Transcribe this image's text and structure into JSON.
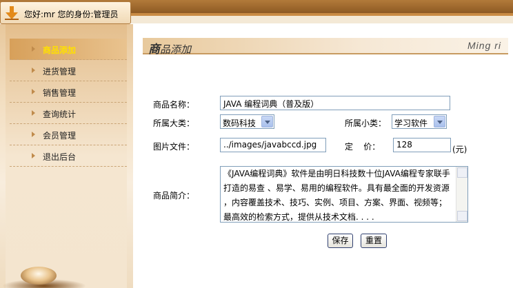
{
  "header": {
    "greeting": "您好:mr 您的身份:管理员"
  },
  "sidebar": {
    "items": [
      {
        "label": "商品添加",
        "active": true
      },
      {
        "label": "进货管理",
        "active": false
      },
      {
        "label": "销售管理",
        "active": false
      },
      {
        "label": "查询统计",
        "active": false
      },
      {
        "label": "会员管理",
        "active": false
      },
      {
        "label": "退出后台",
        "active": false
      }
    ]
  },
  "page": {
    "title_bold": "商",
    "title_rest": "品添加",
    "brand": "Ming ri"
  },
  "form": {
    "name_label": "商品名称：",
    "name_value": "JAVA 编程词典（普及版）",
    "category_label": "所属大类：",
    "category_value": "数码科技",
    "subcategory_label": "所属小类：",
    "subcategory_value": "学习软件",
    "image_label": "图片文件：",
    "image_value": "../images/javabccd.jpg",
    "price_label": "定    价：",
    "price_value": "128",
    "price_unit": "(元)",
    "intro_label": "商品简介：",
    "intro_lines": [
      "《JAVA编程词典》软件是由明日科技数十位JAVA编程专家联手",
      "打造的易查 、易学、易用的编程软件。具有最全面的开发资源",
      "，内容覆盖技术、技巧、实例、项目、方案、界面、视频等；",
      "最高效的检索方式，提供从技术文档. . . ."
    ],
    "save_label": "保存",
    "reset_label": "重置"
  },
  "colors": {
    "active_nav_text": "#ffe000",
    "header_brown": "#8d5a23"
  }
}
